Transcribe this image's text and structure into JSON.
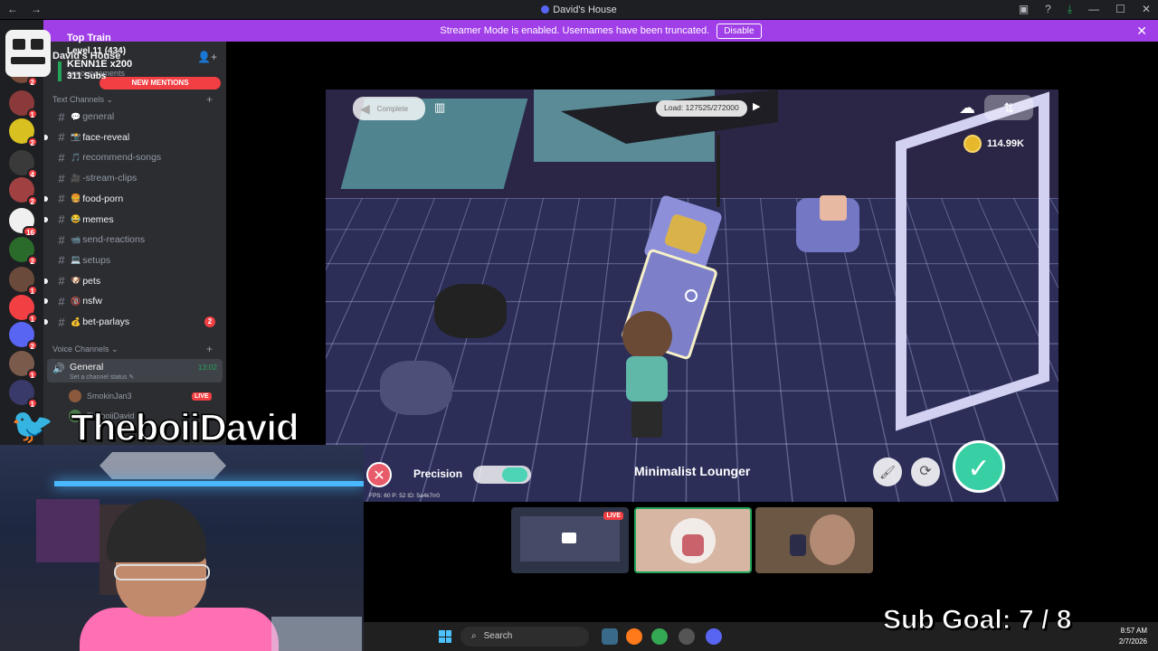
{
  "window": {
    "title": "David's House",
    "back": "←",
    "forward": "→"
  },
  "streamer_bar": {
    "message": "Streamer Mode is enabled. Usernames have been truncated.",
    "disable_label": "Disable",
    "close": "✕"
  },
  "servers": [
    {
      "badge": "2",
      "color": "#7a4a3a"
    },
    {
      "badge": "1",
      "color": "#8a3a3a"
    },
    {
      "badge": "2",
      "color": "#d8c020"
    },
    {
      "badge": "4",
      "color": "#3a3a3a"
    },
    {
      "badge": "2",
      "color": "#a04040"
    },
    {
      "badge": "16",
      "color": "#f0f0f0"
    },
    {
      "badge": "2",
      "color": "#2a6a2a"
    },
    {
      "badge": "1",
      "color": "#6a4a3a"
    },
    {
      "badge": "1",
      "color": "#f23f43"
    },
    {
      "badge": "2",
      "color": "#5865f2"
    },
    {
      "badge": "1",
      "color": "#7a5a4a"
    },
    {
      "badge": "1",
      "color": "#3a3a6a"
    }
  ],
  "overlay": {
    "top_train": "Top Train",
    "level": "Level 11 (434)",
    "kenn": "KENN1E x200",
    "subs": "311 Subs"
  },
  "sidebar": {
    "server_name": "David's House",
    "announcements": "announcements",
    "new_mentions": "NEW MENTIONS",
    "text_category": "Text Channels",
    "voice_category": "Voice Channels",
    "channels": [
      {
        "name": "general",
        "emoji": "💬",
        "unread": false,
        "badge": ""
      },
      {
        "name": "face-reveal",
        "emoji": "📸",
        "unread": true,
        "badge": ""
      },
      {
        "name": "recommend-songs",
        "emoji": "🎵",
        "unread": false,
        "badge": ""
      },
      {
        "name": "-stream-clips",
        "emoji": "🎥",
        "unread": false,
        "badge": ""
      },
      {
        "name": "food-porn",
        "emoji": "🍔",
        "unread": true,
        "badge": ""
      },
      {
        "name": "memes",
        "emoji": "😂",
        "unread": true,
        "badge": ""
      },
      {
        "name": "send-reactions",
        "emoji": "📹",
        "unread": false,
        "badge": ""
      },
      {
        "name": "setups",
        "emoji": "💻",
        "unread": false,
        "badge": ""
      },
      {
        "name": "pets",
        "emoji": "🐶",
        "unread": true,
        "badge": ""
      },
      {
        "name": "nsfw",
        "emoji": "🔞",
        "unread": true,
        "badge": ""
      },
      {
        "name": "bet-parlays",
        "emoji": "💰",
        "unread": true,
        "badge": "2"
      }
    ],
    "voice": {
      "name": "General",
      "time": "13:02",
      "status_placeholder": "Set a channel status",
      "users": [
        {
          "name": "SmokinJan3",
          "live": "LIVE"
        },
        {
          "name": "TheboiiDavid",
          "live": ""
        }
      ]
    }
  },
  "game": {
    "complete": "Complete",
    "load_label": "Load:",
    "load_value": "127525/272000",
    "coins": "114.99K",
    "precision": "Precision",
    "item_name": "Minimalist Lounger",
    "debug": "FPS: 60   P: 52   ID: 5a4k7rr0"
  },
  "tiles": {
    "live": "LIVE"
  },
  "twitter_handle": "TheboiiDavid",
  "sub_goal": "Sub Goal:  7 / 8",
  "taskbar": {
    "search": "Search",
    "time": "8:57 AM",
    "date": "2/7/2026"
  }
}
